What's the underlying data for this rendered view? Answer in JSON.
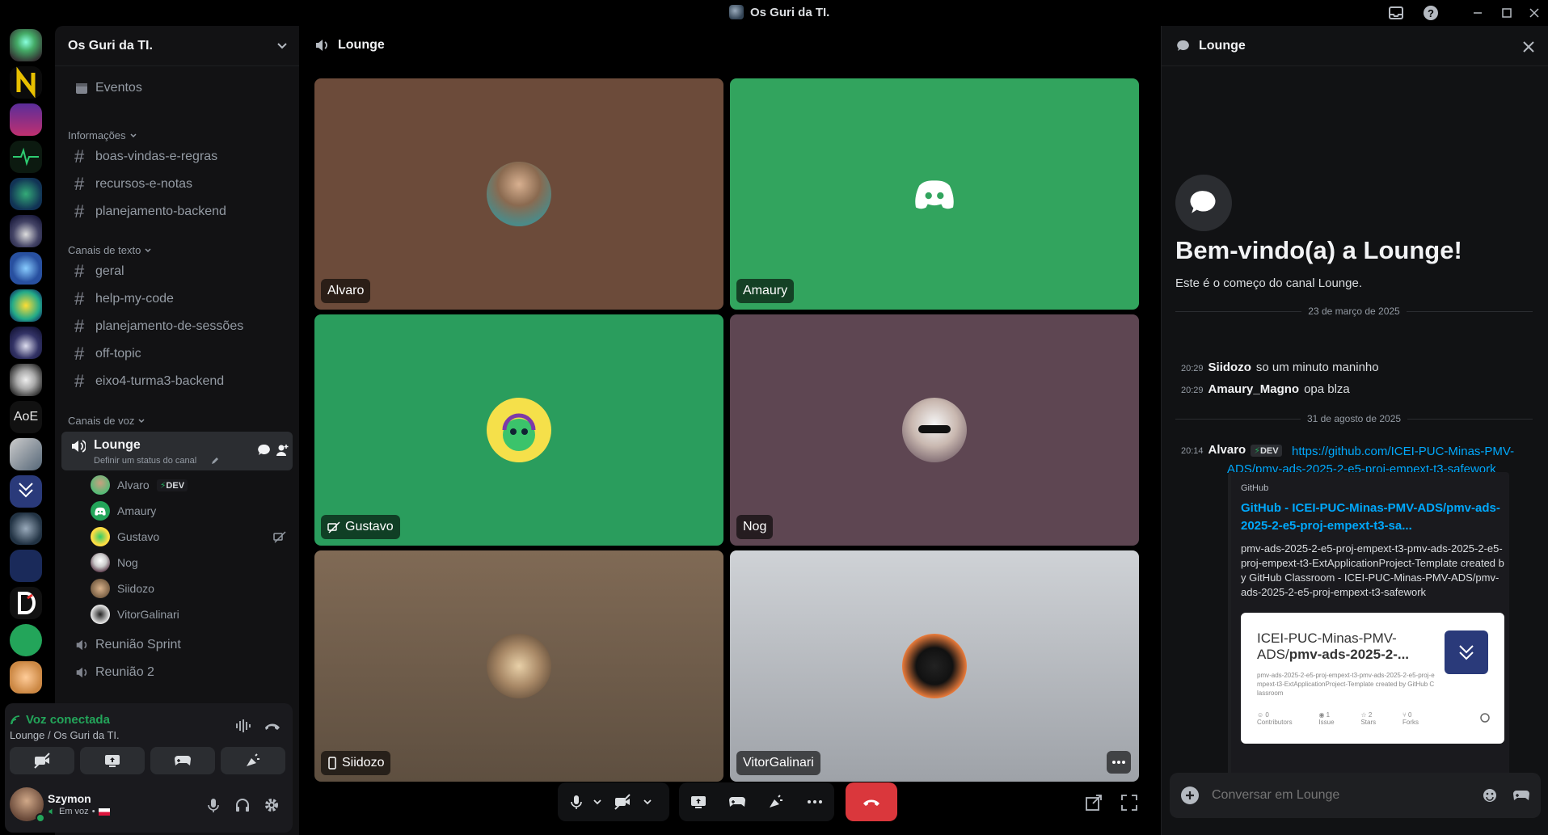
{
  "window": {
    "title": "Os Guri da TI."
  },
  "server_rail": {
    "aoe_label": "AoE"
  },
  "sidebar": {
    "guild_name": "Os Guri da TI.",
    "events_label": "Eventos",
    "categories": {
      "info": "Informações",
      "text": "Canais de texto",
      "voice": "Canais de voz"
    },
    "info_channels": [
      "boas-vindas-e-regras",
      "recursos-e-notas",
      "planejamento-backend"
    ],
    "text_channels": [
      "geral",
      "help-my-code",
      "planejamento-de-sessões",
      "off-topic",
      "eixo4-turma3-backend"
    ],
    "active_voice": {
      "name": "Lounge",
      "status": "Definir um status do canal"
    },
    "voice_members": [
      {
        "name": "Alvaro",
        "badge": "DEV"
      },
      {
        "name": "Amaury"
      },
      {
        "name": "Gustavo"
      },
      {
        "name": "Nog"
      },
      {
        "name": "Siidozo"
      },
      {
        "name": "VitorGalinari"
      }
    ],
    "other_voice": [
      "Reunião Sprint",
      "Reunião 2"
    ]
  },
  "voice_panel": {
    "status": "Voz conectada",
    "location": "Lounge / Os Guri da TI."
  },
  "user": {
    "name": "Szymon",
    "status": "Em voz"
  },
  "main": {
    "channel": "Lounge",
    "tiles": [
      {
        "name": "Alvaro",
        "bg": "#6c4b3a"
      },
      {
        "name": "Amaury",
        "bg": "#32a45e"
      },
      {
        "name": "Gustavo",
        "bg": "#2a9d5d"
      },
      {
        "name": "Nog",
        "bg": "#5e4652"
      },
      {
        "name": "Siidozo",
        "bg": "#806a55"
      },
      {
        "name": "VitorGalinari",
        "bg": "#c6c9ce"
      }
    ]
  },
  "chat": {
    "header": "Lounge",
    "welcome_title": "Bem-vindo(a) a Lounge!",
    "welcome_sub": "Este é o começo do canal Lounge.",
    "date1": "23 de março de 2025",
    "date2": "31 de agosto de 2025",
    "messages": [
      {
        "time": "20:29",
        "author": "Siidozo",
        "text": "so um minuto maninho"
      },
      {
        "time": "20:29",
        "author": "Amaury_Magno",
        "text": "opa blza"
      },
      {
        "time": "20:14",
        "author": "Alvaro",
        "badge": "DEV",
        "link": "https://github.com/ICEI-PUC-Minas-PMV-ADS/pmv-ads-2025-2-e5-proj-empext-t3-safework"
      }
    ],
    "embed": {
      "provider": "GitHub",
      "title": "GitHub - ICEI-PUC-Minas-PMV-ADS/pmv-ads-2025-2-e5-proj-empext-t3-sa...",
      "description": "pmv-ads-2025-2-e5-proj-empext-t3-pmv-ads-2025-2-e5-proj-empext-t3-ExtApplicationProject-Template created by GitHub Classroom - ICEI-PUC-Minas-PMV-ADS/pmv-ads-2025-2-e5-proj-empext-t3-safework",
      "card_title_plain": "ICEI-PUC-Minas-PMV-ADS/",
      "card_title_bold": "pmv-ads-2025-2-...",
      "card_desc": "pmv-ads-2025-2-e5-proj-empext-t3-pmv-ads-2025-2-e5-proj-empext-t3-ExtApplicationProject-Template created by GitHub Classroom",
      "stats": [
        {
          "value": "0",
          "label": "Contributors"
        },
        {
          "value": "1",
          "label": "Issue"
        },
        {
          "value": "2",
          "label": "Stars"
        },
        {
          "value": "0",
          "label": "Forks"
        }
      ]
    },
    "input_placeholder": "Conversar em Lounge"
  },
  "colors": {
    "accent_green": "#23a55a",
    "hangup_red": "#da373c",
    "link_blue": "#00a8fc"
  }
}
